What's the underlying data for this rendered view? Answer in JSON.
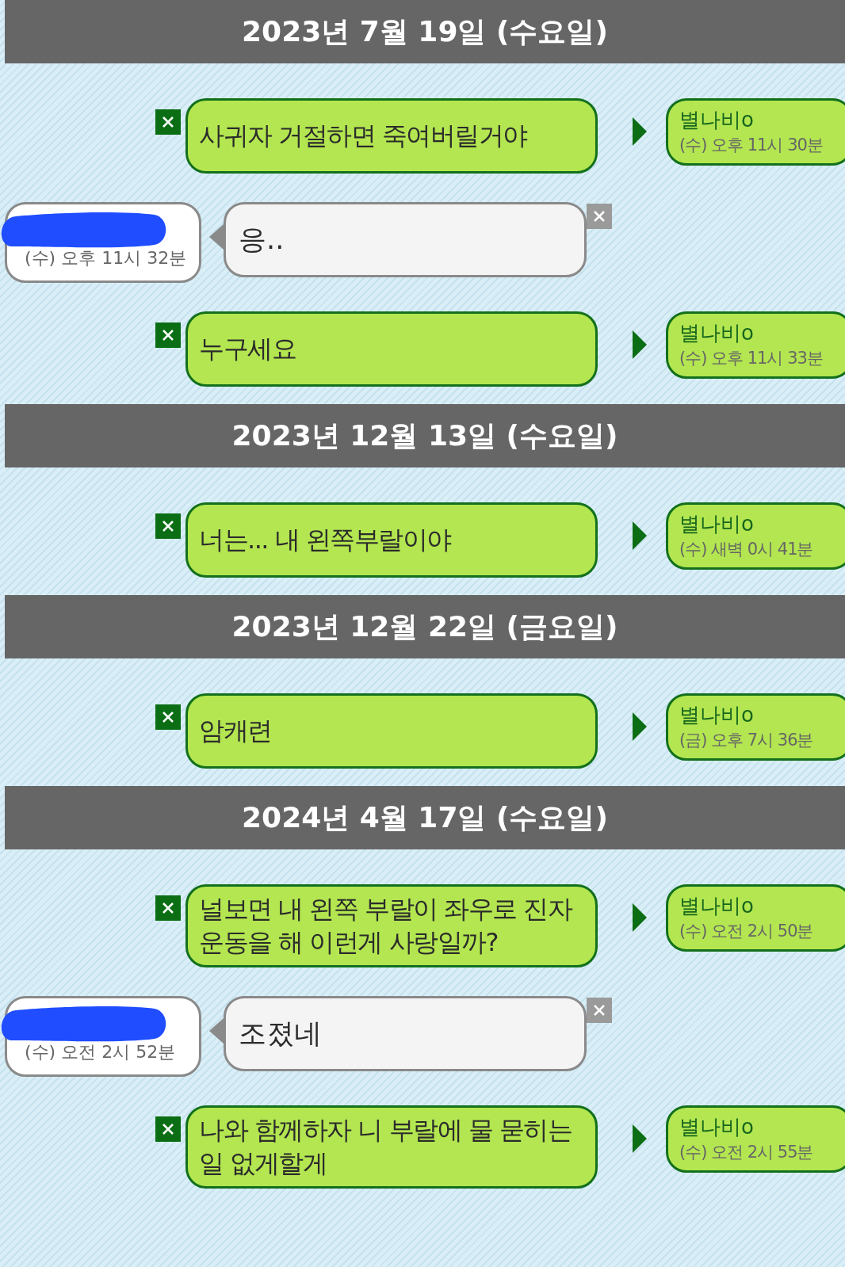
{
  "sections": [
    {
      "date": "2023년 7월 19일 (수요일)",
      "messages": [
        {
          "kind": "sent",
          "text": "사귀자 거절하면 죽여버릴거야",
          "sender": "별나비o",
          "time": "(수) 오후 11시 30분"
        },
        {
          "kind": "received",
          "text": "응..",
          "time": "(수) 오후 11시 32분"
        },
        {
          "kind": "sent",
          "text": "누구세요",
          "sender": "별나비o",
          "time": "(수) 오후 11시 33분"
        }
      ]
    },
    {
      "date": "2023년 12월 13일 (수요일)",
      "messages": [
        {
          "kind": "sent",
          "text": "너는... 내 왼쪽부랄이야",
          "sender": "별나비o",
          "time": "(수) 새벽 0시 41분"
        }
      ]
    },
    {
      "date": "2023년 12월 22일 (금요일)",
      "messages": [
        {
          "kind": "sent",
          "text": "암캐련",
          "sender": "별나비o",
          "time": "(금) 오후 7시 36분"
        }
      ]
    },
    {
      "date": "2024년 4월 17일 (수요일)",
      "messages": [
        {
          "kind": "sent",
          "text": "널보면 내 왼쪽 부랄이 좌우로 진자운동을 해 이런게 사랑일까?",
          "sender": "별나비o",
          "time": "(수) 오전 2시 50분"
        },
        {
          "kind": "received",
          "text": "조졌네",
          "time": "(수) 오전 2시 52분"
        },
        {
          "kind": "sent",
          "text": "나와 함께하자 니 부랄에 물 묻히는일 없게할게",
          "sender": "별나비o",
          "time": "(수) 오전 2시 55분"
        }
      ]
    }
  ]
}
